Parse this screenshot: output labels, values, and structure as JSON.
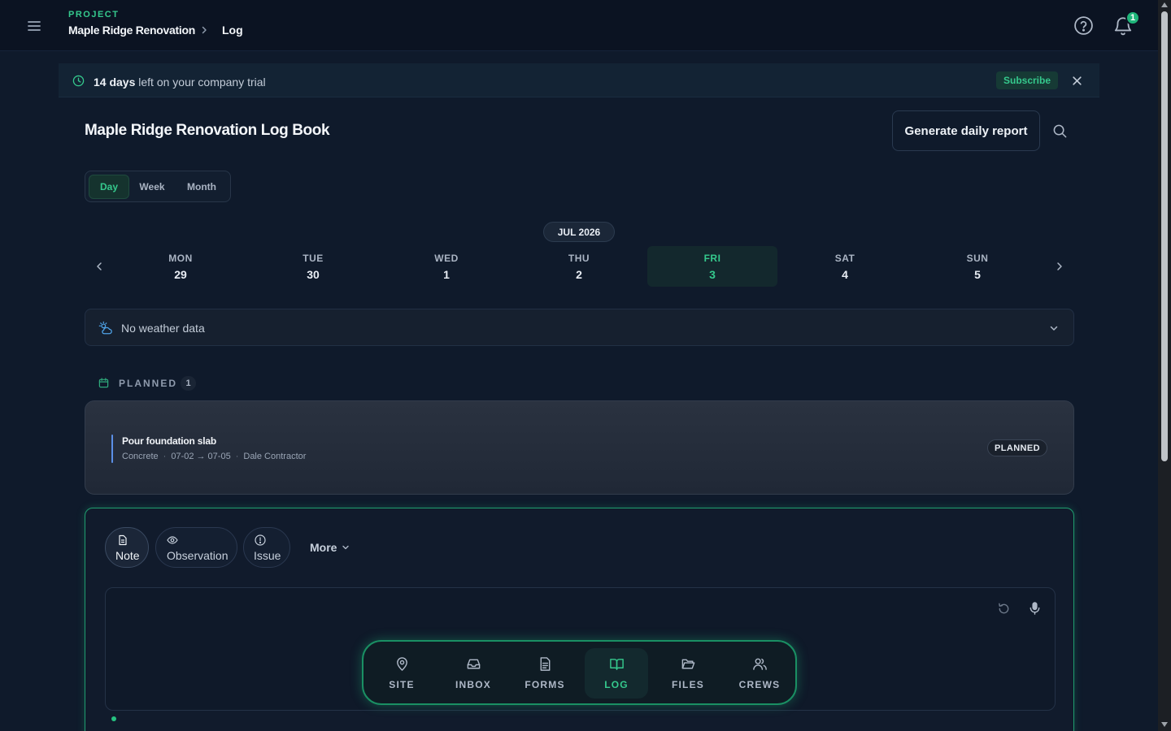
{
  "header": {
    "project_label": "PROJECT",
    "project_name": "Maple Ridge Renovation",
    "current_page": "Log",
    "notification_count": "1"
  },
  "trial_banner": {
    "days": "14 days",
    "text": " left on your company trial",
    "subscribe_label": "Subscribe"
  },
  "page": {
    "title": "Maple Ridge Renovation Log Book",
    "report_button": "Generate daily report"
  },
  "view_toggle": {
    "options": [
      "Day",
      "Week",
      "Month"
    ],
    "selected": "Day"
  },
  "calendar": {
    "month_label": "JUL 2026",
    "days": [
      {
        "name": "MON",
        "num": "29"
      },
      {
        "name": "TUE",
        "num": "30"
      },
      {
        "name": "WED",
        "num": "1"
      },
      {
        "name": "THU",
        "num": "2"
      },
      {
        "name": "FRI",
        "num": "3"
      },
      {
        "name": "SAT",
        "num": "4"
      },
      {
        "name": "SUN",
        "num": "5"
      }
    ],
    "selected_day": "FRI 3"
  },
  "weather": {
    "text": "No weather data"
  },
  "planned": {
    "label": "PLANNED",
    "count": "1",
    "items": [
      {
        "title": "Pour foundation slab",
        "trade": "Concrete",
        "dates": "07-02 → 07-05",
        "assignee": "Dale Contractor",
        "status": "PLANNED"
      }
    ]
  },
  "composer": {
    "types": [
      "Note",
      "Observation",
      "Issue"
    ],
    "selected_type": "Note",
    "more_label": "More"
  },
  "bottom_nav": {
    "items": [
      {
        "label": "SITE",
        "icon": "map-pin-icon"
      },
      {
        "label": "INBOX",
        "icon": "inbox-icon"
      },
      {
        "label": "FORMS",
        "icon": "document-icon"
      },
      {
        "label": "LOG",
        "icon": "book-open-icon"
      },
      {
        "label": "FILES",
        "icon": "folder-open-icon"
      },
      {
        "label": "CREWS",
        "icon": "users-icon"
      }
    ],
    "active": "LOG"
  },
  "colors": {
    "accent": "#35c98d",
    "background": "#0f1a2b",
    "planned_accent": "#5b8fe6"
  }
}
